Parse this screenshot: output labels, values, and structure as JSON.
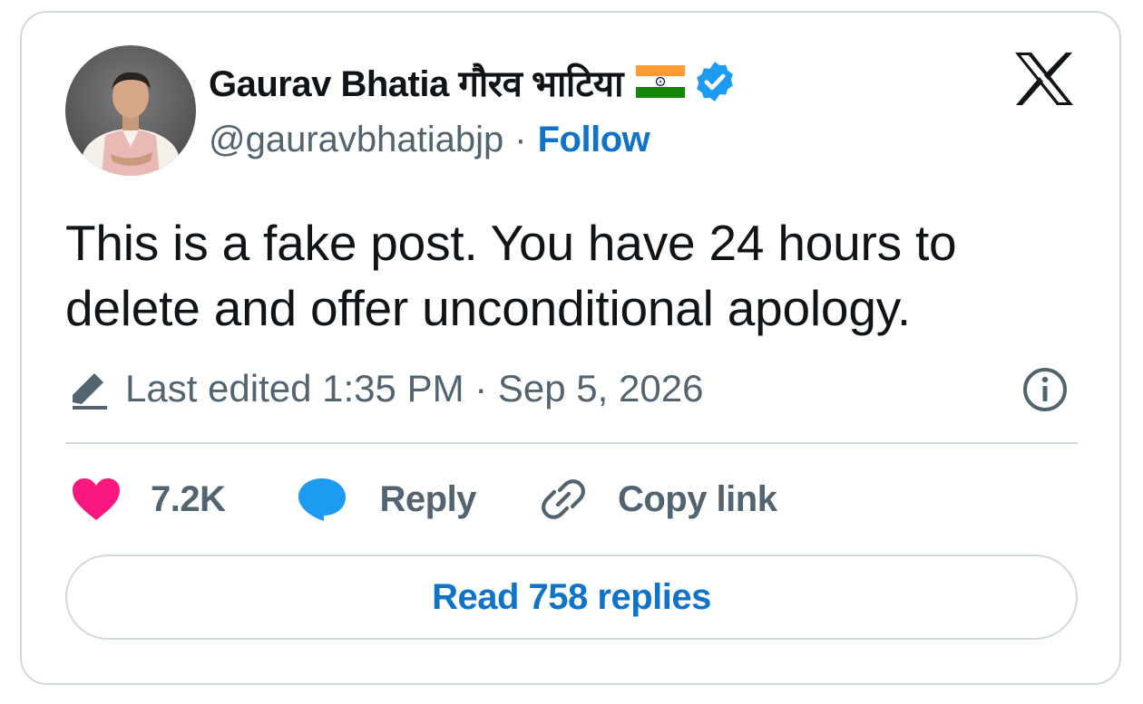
{
  "author": {
    "display_name": "Gaurav Bhatia गौरव भाटिया",
    "handle": "@gauravbhatiabjp",
    "separator": "·",
    "follow_label": "Follow",
    "flag_icon": "india-flag-icon",
    "verified_icon": "verified-badge-icon"
  },
  "tweet": {
    "text": "This is a fake post. You have 24 hours to delete and offer unconditional apology.",
    "edited_label": "Last edited 1:35 PM · Sep 5, 2026"
  },
  "actions": {
    "like_count": "7.2K",
    "reply_label": "Reply",
    "copy_link_label": "Copy link"
  },
  "read_replies_label": "Read 758 replies",
  "colors": {
    "accent": "#0f73c8",
    "like": "#f91880",
    "reply": "#1d9bf0",
    "muted": "#536471",
    "border": "#cfd9de"
  }
}
